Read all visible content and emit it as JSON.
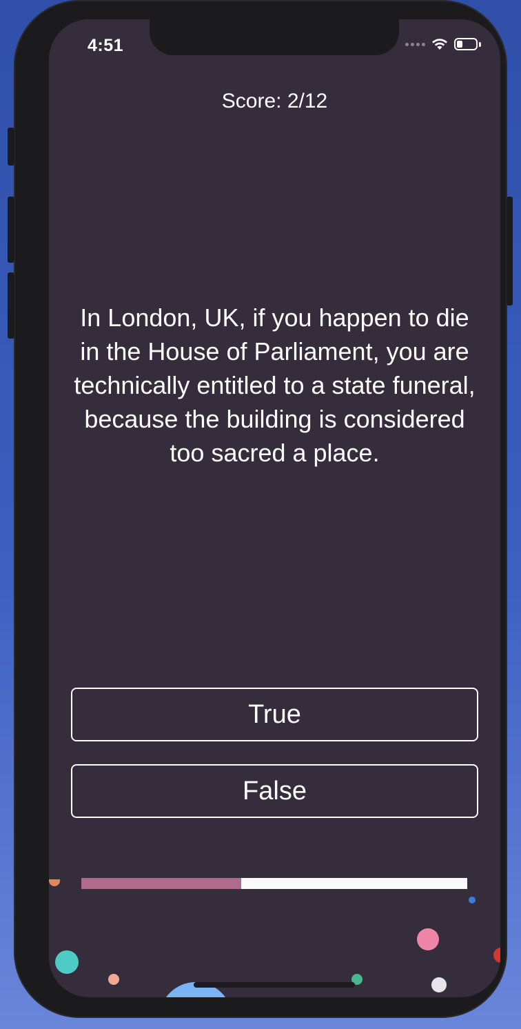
{
  "status_bar": {
    "time": "4:51",
    "wifi_icon": "wifi-icon",
    "battery_icon": "battery-icon",
    "battery_level": 0.3
  },
  "quiz": {
    "score_text": "Score: 2/12",
    "question": "In London, UK, if you happen to die in the House of Parliament, you are technically entitled to a state funeral, because the building is considered too sacred a place.",
    "true_label": "True",
    "false_label": "False",
    "progress_fraction": 0.415
  },
  "colors": {
    "background": "#352d3b",
    "progress_fill": "#ae6b8a",
    "progress_track": "#fafafa",
    "text": "#ffffff"
  }
}
